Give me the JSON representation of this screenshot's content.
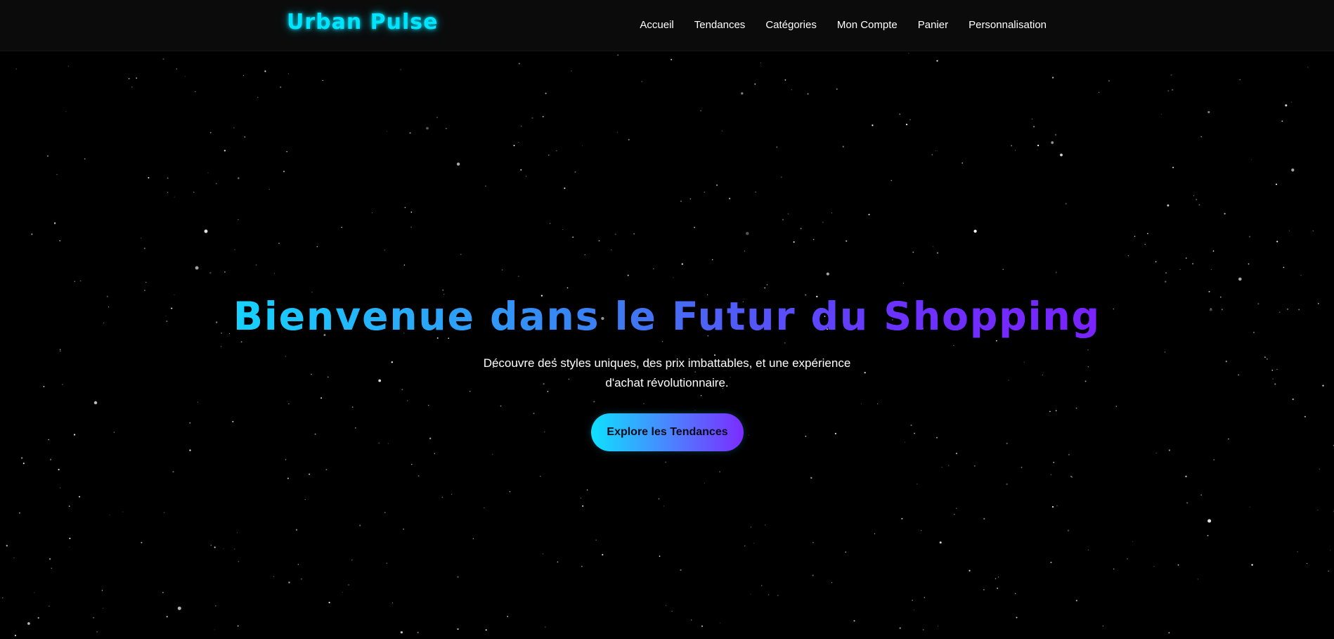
{
  "brand": {
    "name": "Urban Pulse",
    "color": "#00e5ff"
  },
  "nav": {
    "items": [
      {
        "label": "Accueil"
      },
      {
        "label": "Tendances"
      },
      {
        "label": "Catégories"
      },
      {
        "label": "Mon Compte"
      },
      {
        "label": "Panier"
      },
      {
        "label": "Personnalisation"
      }
    ]
  },
  "hero": {
    "title": "Bienvenue dans le Futur du Shopping",
    "subtitle_line1": "Découvre des styles uniques, des prix imbattables, et une expérience",
    "subtitle_line2": "d'achat révolutionnaire.",
    "cta_label": "Explore les Tendances"
  },
  "theme": {
    "background": "#000000",
    "gradient_start": "#00e5ff",
    "gradient_end": "#7b2cff"
  }
}
